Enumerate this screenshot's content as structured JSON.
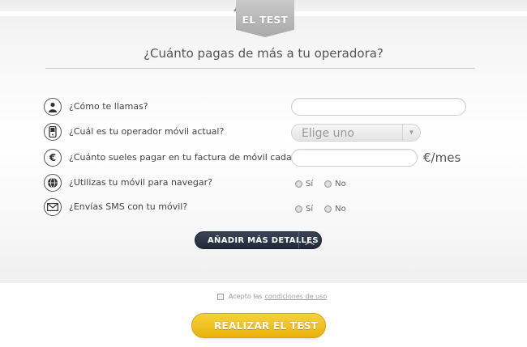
{
  "header": {
    "tab_label": "EL TEST"
  },
  "form": {
    "question": "¿Cuánto pagas de más a tu operadora?",
    "rows": [
      {
        "icon": "person-icon",
        "label": "¿Cómo te llamas?"
      },
      {
        "icon": "phone-icon",
        "label": "¿Cuál es tu operador móvil actual?"
      },
      {
        "icon": "euro-icon",
        "label": "¿Cuánto sueles pagar en tu factura de móvil cada mes?"
      },
      {
        "icon": "globe-icon",
        "label": "¿Utilizas tu móvil para navegar?"
      },
      {
        "icon": "envelope-icon",
        "label": "¿Envías SMS con tu móvil?"
      }
    ],
    "name_value": "",
    "operator_select": {
      "selected": "Elige uno"
    },
    "monthly_value": "",
    "monthly_unit": "€/mes",
    "radio_yes": "Sí",
    "radio_no": "No"
  },
  "details_button": {
    "label": "AÑADIR MÁS DETALLES"
  },
  "terms": {
    "prefix": "Acepto las",
    "link": "condiciones de uso"
  },
  "cta": {
    "label": "REALIZAR EL TEST"
  },
  "colors": {
    "accent_yellow": "#f0c020",
    "dark_button": "#2b3344"
  }
}
